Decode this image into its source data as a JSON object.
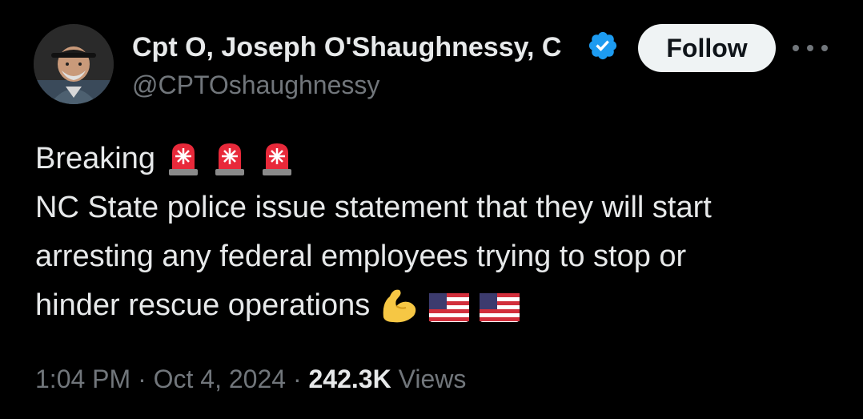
{
  "author": {
    "display_name": "Cpt O, Joseph O'Shaughnessy, C",
    "handle": "@CPTOshaughnessy",
    "verified_icon": "verified-badge-icon",
    "verified_color": "#1d9bf0"
  },
  "actions": {
    "follow_label": "Follow",
    "more_icon": "more-options-icon"
  },
  "tweet": {
    "line1_text": "Breaking",
    "line1_emojis": [
      "police-light-emoji",
      "police-light-emoji",
      "police-light-emoji"
    ],
    "line2_text": "NC State police issue statement that they will start",
    "line3_text": "arresting any federal employees trying to stop or",
    "line4_text": "hinder rescue operations",
    "line4_emojis": [
      "flexed-biceps-emoji",
      "us-flag-emoji",
      "us-flag-emoji"
    ]
  },
  "meta": {
    "time": "1:04 PM",
    "separator": "·",
    "date": "Oct 4, 2024",
    "views_count": "242.3K",
    "views_label": "Views"
  },
  "colors": {
    "background": "#000000",
    "primary_text": "#e7e9ea",
    "secondary_text": "#71767b",
    "follow_bg": "#eff3f4",
    "follow_text": "#0f1419"
  }
}
